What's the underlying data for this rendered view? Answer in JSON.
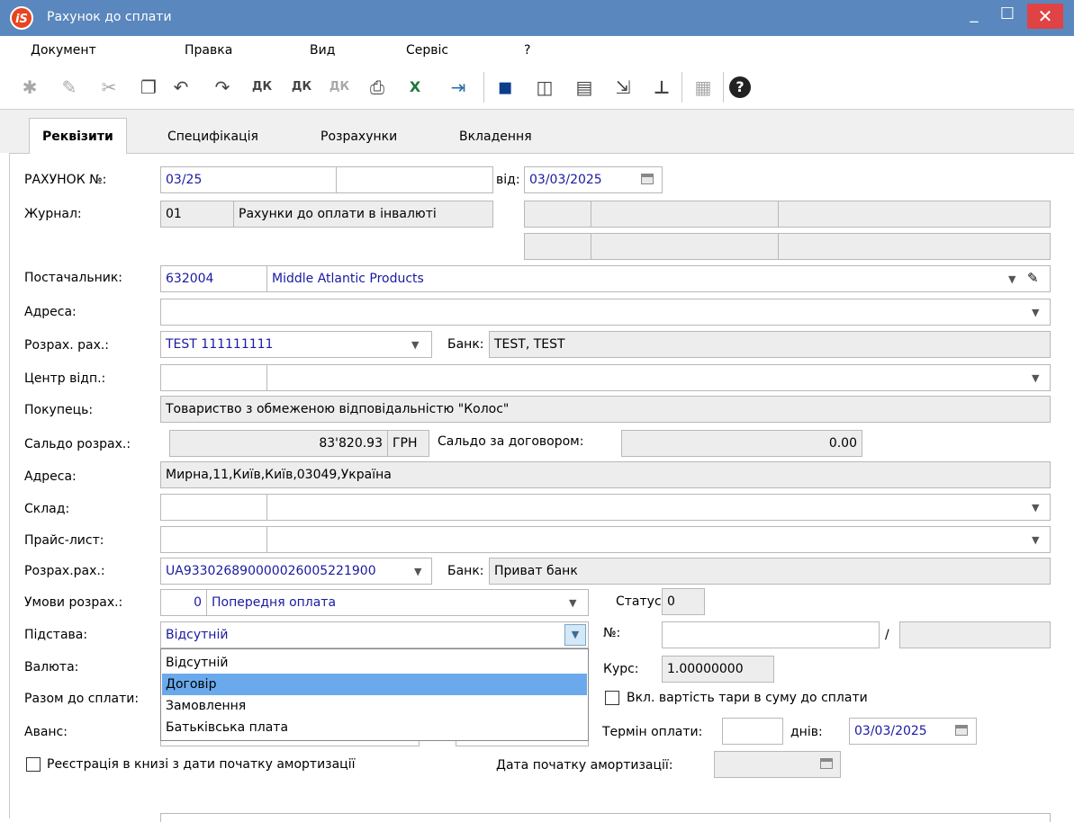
{
  "window": {
    "title": "Рахунок до сплати",
    "logo_text": "iS",
    "min_glyph": "_",
    "max_glyph": "☐",
    "close_glyph": "✕"
  },
  "menu": [
    "Документ",
    "Правка",
    "Вид",
    "Сервіс",
    "?"
  ],
  "toolbar": {
    "icons": [
      "new-doc-icon",
      "edit-doc-icon",
      "delete-doc-icon",
      "copy-icon",
      "undo-icon",
      "redo-icon",
      "debit-credit-icon",
      "debit-credit-2-icon",
      "debit-credit-3-icon",
      "print-icon",
      "excel-icon",
      "exit-icon",
      "save-icon",
      "book-icon",
      "folder-icon",
      "export-icon",
      "hierarchy-icon",
      "grid-icon",
      "help-icon"
    ],
    "glyphs": [
      "✱",
      "✎",
      "✂",
      "❐",
      "↶",
      "↷",
      "ДК",
      "ДК",
      "ДК",
      "⎙",
      "X",
      "⇥",
      "▪",
      "◫",
      "▤",
      "⇲",
      "⊥",
      "▦",
      "?"
    ]
  },
  "tabs": [
    "Реквізити",
    "Специфікація",
    "Розрахунки",
    "Вкладення"
  ],
  "form": {
    "invoice_no_label": "РАХУНОК №:",
    "invoice_no": "03/25",
    "invoice_suffix": "",
    "date_label": "від:",
    "date": "03/03/2025",
    "journal_label": "Журнал:",
    "journal_code": "01",
    "journal_name": "Рахунки до оплати в інвалюті",
    "supplier_label": "Постачальник:",
    "supplier_code": "632004",
    "supplier_name": "Middle Atlantic Products",
    "address_label": "Адреса:",
    "address": "",
    "account_label": "Розрах. рах.:",
    "account": "TEST 111111111",
    "bank_label": "Банк:",
    "bank": "TEST, TEST",
    "center_label": "Центр відп.:",
    "buyer_label": "Покупець:",
    "buyer": "Товариство з обмеженою відповідальністю \"Колос\"",
    "balance_label": "Сальдо розрах.:",
    "balance": "83'820.93",
    "currency_code": "ГРН",
    "contract_balance_label": "Сальдо за договором:",
    "contract_balance": "0.00",
    "buyer_address_label": "Адреса:",
    "buyer_address": "Мирна,11,Київ,Київ,03049,Україна",
    "warehouse_label": "Склад:",
    "pricelist_label": "Прайс-лист:",
    "buyer_account_label": "Розрах.рах.:",
    "buyer_account": "UA933026890000026005221900",
    "buyer_bank_label": "Банк:",
    "buyer_bank": "Приват банк",
    "terms_label": "Умови розрах.:",
    "terms_code": "0",
    "terms_name": "Попередня оплата",
    "status_label": "Статус:",
    "status": "0",
    "basis_label": "Підстава:",
    "basis": "Відсутній",
    "no_label": "№:",
    "slash": "/",
    "currency_label": "Валюта:",
    "rate_label": "Курс:",
    "rate": "1.00000000",
    "total_label": "Разом до сплати:",
    "include_tare_label": "Вкл. вартість тари в суму до сплати",
    "advance_label": "Аванс:",
    "pay_term_label": "Термін оплати:",
    "days_label": "днів:",
    "pay_date": "03/03/2025",
    "register_label": "Реєстрація в книзі з дати початку амортизації",
    "amort_date_label": "Дата початку амортизації:"
  },
  "basis_options": [
    "Відсутній",
    "Договір",
    "Замовлення",
    "Батьківська плата"
  ],
  "basis_highlighted": "Договір"
}
